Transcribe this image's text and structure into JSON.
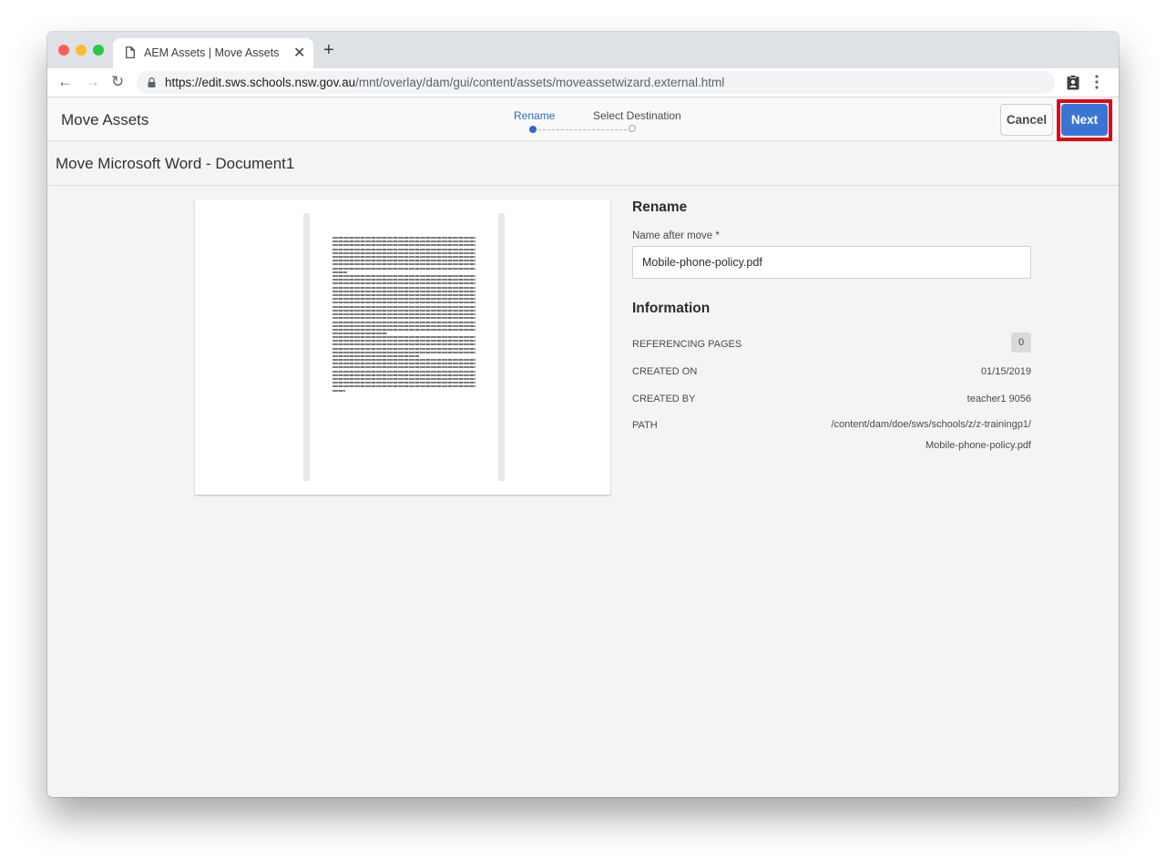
{
  "browser": {
    "tab_title": "AEM Assets | Move Assets",
    "url_host": "https://edit.sws.schools.nsw.gov.au",
    "url_path": "/mnt/overlay/dam/gui/content/assets/moveassetwizard.external.html",
    "new_tab_glyph": "+",
    "close_glyph": "✕",
    "back_glyph": "←",
    "forward_glyph": "→",
    "reload_glyph": "↻"
  },
  "header": {
    "title": "Move Assets",
    "steps": [
      {
        "label": "Rename",
        "state": "active"
      },
      {
        "label": "Select Destination",
        "state": "inactive"
      }
    ],
    "cancel_label": "Cancel",
    "next_label": "Next",
    "accent_color": "#2c6bc2",
    "highlight_color": "#e3000f"
  },
  "subheader": {
    "title": "Move Microsoft Word - Document1"
  },
  "rename": {
    "heading": "Rename",
    "field_label": "Name after move *",
    "field_value": "Mobile-phone-policy.pdf"
  },
  "information": {
    "heading": "Information",
    "rows": [
      {
        "key": "REFERENCING PAGES",
        "value": "0"
      },
      {
        "key": "CREATED ON",
        "value": "01/15/2019"
      },
      {
        "key": "CREATED BY",
        "value": "teacher1 9056"
      },
      {
        "key": "PATH",
        "value": "/content/dam/doe/sws/schools/z/z-trainingp1/Mobile-phone-policy.pdf"
      }
    ]
  }
}
